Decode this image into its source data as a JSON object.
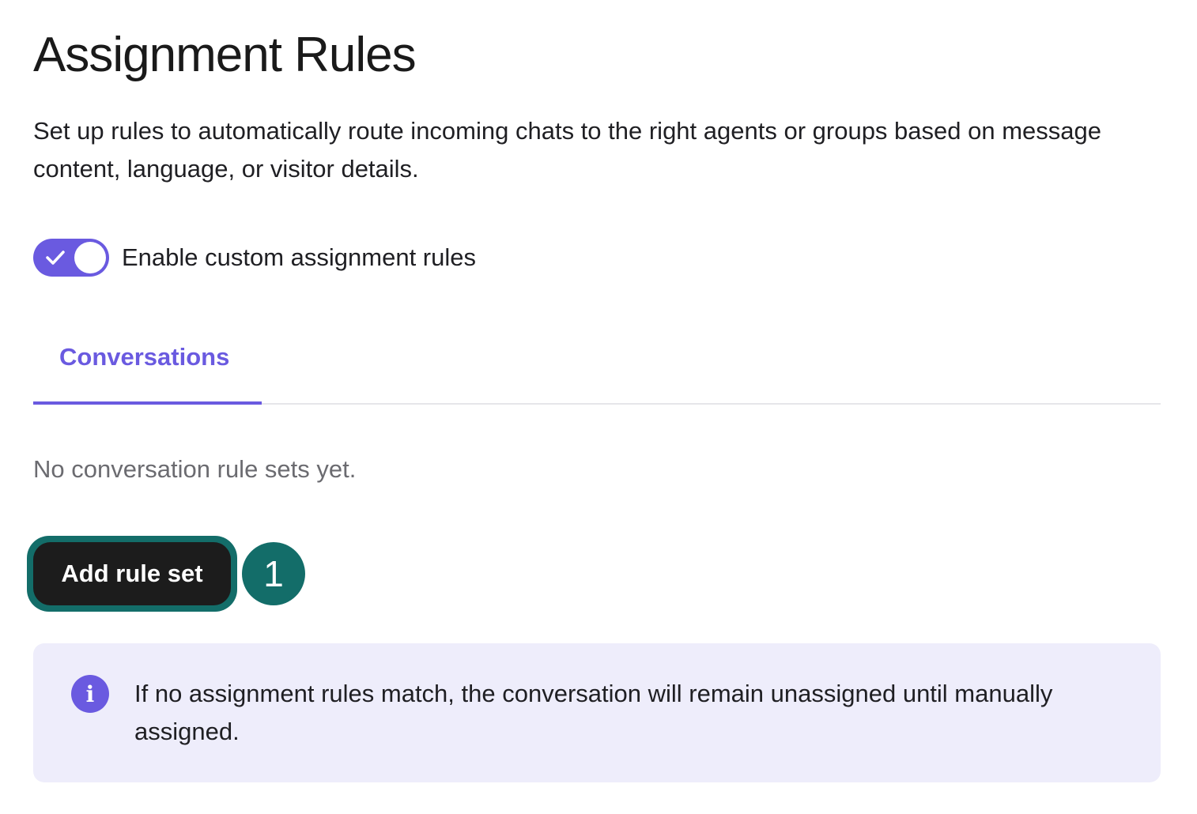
{
  "header": {
    "title": "Assignment Rules",
    "description": "Set up rules to automatically route incoming chats to the right agents or groups based on message content, language, or visitor details."
  },
  "toggle": {
    "label": "Enable custom assignment rules",
    "enabled": true,
    "accent_color": "#6a5ae0"
  },
  "tabs": [
    {
      "label": "Conversations",
      "active": true
    }
  ],
  "main": {
    "empty_text": "No conversation rule sets yet.",
    "add_button_label": "Add rule set",
    "step_badge": "1",
    "badge_color": "#136d69"
  },
  "info": {
    "icon": "info-icon",
    "text": "If no assignment rules match, the conversation will remain unassigned until manually assigned."
  }
}
